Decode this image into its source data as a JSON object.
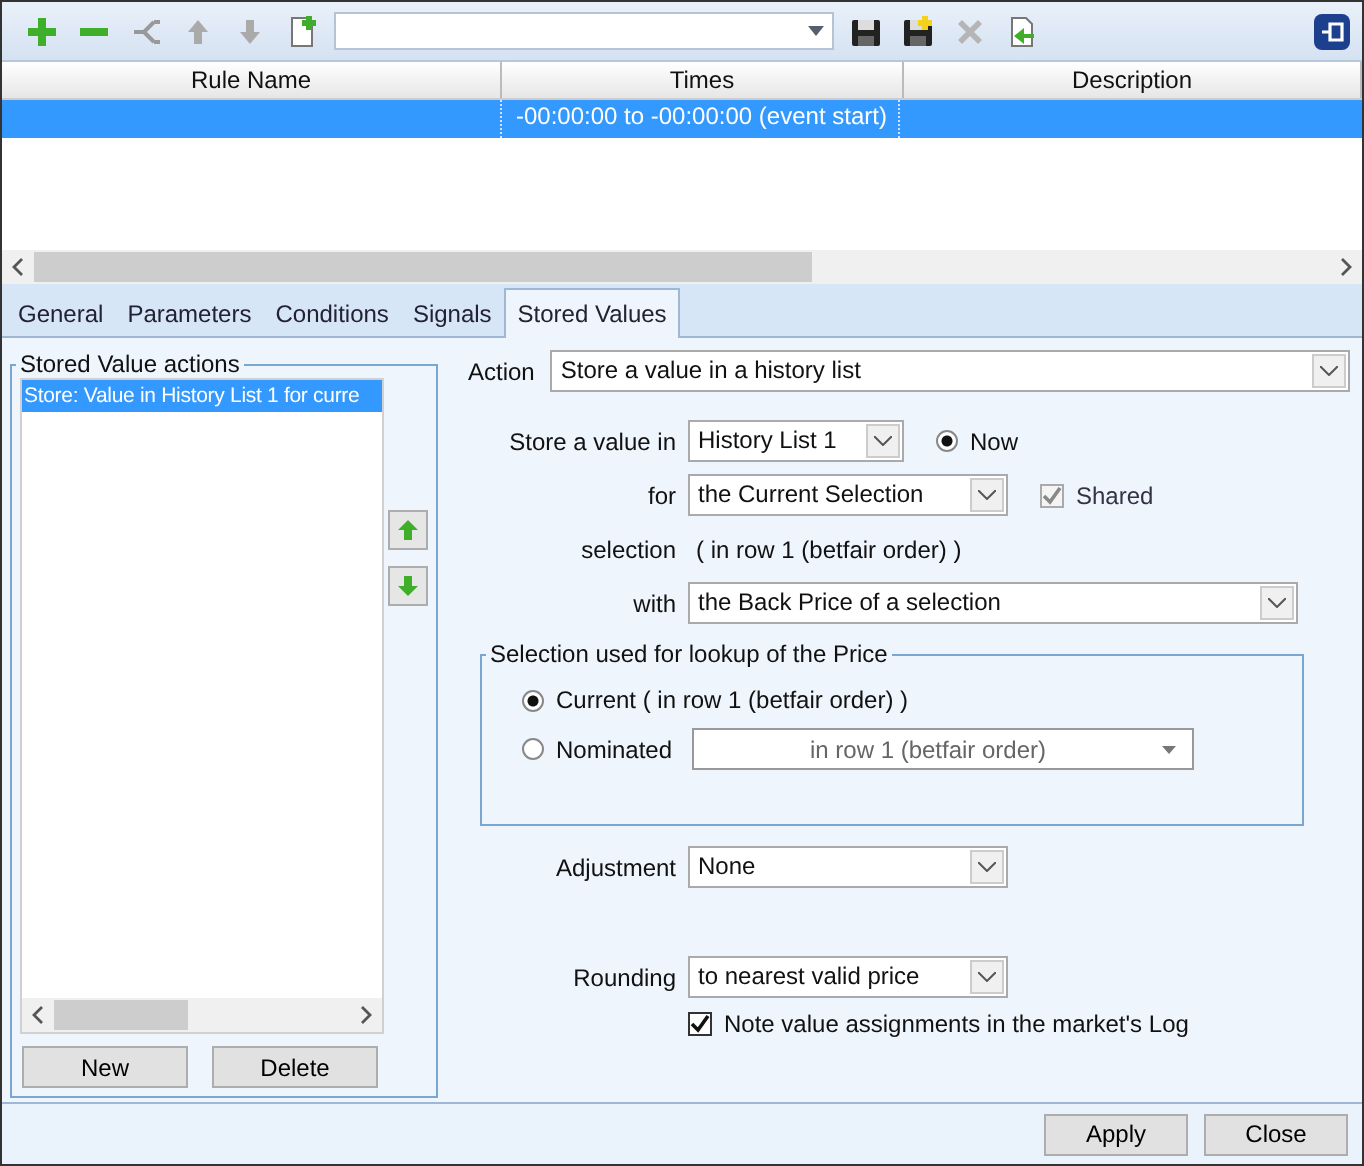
{
  "toolbar": [
    {
      "kind": "add",
      "disabled": false
    },
    {
      "kind": "remove",
      "disabled": false
    },
    {
      "kind": "branch",
      "disabled": true
    },
    {
      "kind": "up",
      "disabled": true
    },
    {
      "kind": "down",
      "disabled": true
    },
    {
      "kind": "new",
      "disabled": false
    },
    {
      "kind": "combo",
      "disabled": false
    },
    {
      "kind": "save",
      "disabled": false
    },
    {
      "kind": "save-add",
      "disabled": false
    },
    {
      "kind": "delete",
      "disabled": true
    },
    {
      "kind": "import",
      "disabled": false
    }
  ],
  "grid": {
    "columns": [
      "Rule Name",
      "Times",
      "Description"
    ],
    "rows": [
      {
        "times": "-00:00:00 to -00:00:00 (event start)",
        "selected": true
      }
    ]
  },
  "tabs": [
    {
      "label": "General",
      "selected": false
    },
    {
      "label": "Parameters",
      "selected": false
    },
    {
      "label": "Conditions",
      "selected": false
    },
    {
      "label": "Signals",
      "selected": false
    },
    {
      "label": "Stored Values",
      "selected": true
    }
  ],
  "actions_group": {
    "title": "Stored Value actions",
    "items": [
      {
        "label": "Store: Value in History List 1 for curre",
        "selected": true
      }
    ],
    "buttons": [
      "New",
      "Delete"
    ]
  },
  "form": {
    "action": {
      "label": "Action",
      "value": "Store a value in a history list"
    },
    "store_in": {
      "label": "Store a value in",
      "value": "History List 1"
    },
    "now": {
      "label": "Now",
      "selected": true
    },
    "for": {
      "label": "for",
      "value": "the Current Selection"
    },
    "shared": {
      "label": "Shared",
      "checked": true,
      "disabled": true
    },
    "selection": {
      "label": "selection",
      "value": "( in row 1 (betfair order) )"
    },
    "with": {
      "label": "with",
      "value": "the Back Price of a selection"
    },
    "lookup": {
      "title": "Selection used for lookup of the Price",
      "options": [
        {
          "label": "Current ( in row 1 (betfair order) )",
          "selected": true
        },
        {
          "label": "Nominated",
          "selected": false
        }
      ],
      "nominated_value": "in row 1 (betfair order)"
    },
    "adjustment": {
      "label": "Adjustment",
      "value": "None"
    },
    "rounding": {
      "label": "Rounding",
      "value": "to nearest valid price"
    },
    "log": {
      "label": "Note value assignments in the market's Log",
      "checked": true
    }
  },
  "footer": [
    "Apply",
    "Close"
  ]
}
